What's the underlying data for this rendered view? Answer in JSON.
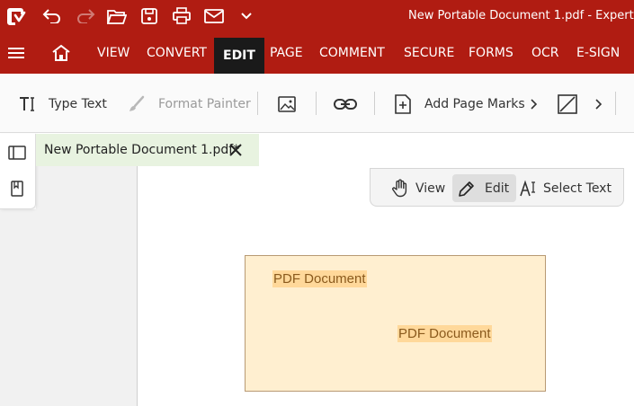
{
  "app": {
    "window_title": "New Portable Document 1.pdf   -   Expert"
  },
  "quick_access": [
    {
      "name": "app-logo-icon"
    },
    {
      "name": "undo-icon"
    },
    {
      "name": "redo-icon"
    },
    {
      "name": "open-folder-icon"
    },
    {
      "name": "save-icon"
    },
    {
      "name": "print-icon"
    },
    {
      "name": "email-icon"
    },
    {
      "name": "customize-dropdown-icon"
    }
  ],
  "ribbon": {
    "tabs": [
      {
        "label": "VIEW"
      },
      {
        "label": "CONVERT"
      },
      {
        "label": "EDIT",
        "active": true
      },
      {
        "label": "PAGE"
      },
      {
        "label": "COMMENT"
      },
      {
        "label": "SECURE"
      },
      {
        "label": "FORMS"
      },
      {
        "label": "OCR"
      },
      {
        "label": "E-SIGN"
      }
    ]
  },
  "toolbar": {
    "type_text": "Type Text",
    "format_painter": "Format Painter",
    "add_page_marks": "Add Page Marks"
  },
  "document": {
    "tab_label": "New Portable Document 1.pdf*"
  },
  "modes": {
    "view": "View",
    "edit": "Edit",
    "select_text": "Select Text",
    "active": "Edit"
  },
  "page": {
    "text_1": "PDF Document",
    "text_2": "PDF Document"
  },
  "colors": {
    "brand_red": "#b01c12",
    "active_tab": "#1a1a1a",
    "doc_tab_bg": "#e8f3e0",
    "page_bg": "#ffefd0",
    "text_highlight": "#ffd89a"
  }
}
